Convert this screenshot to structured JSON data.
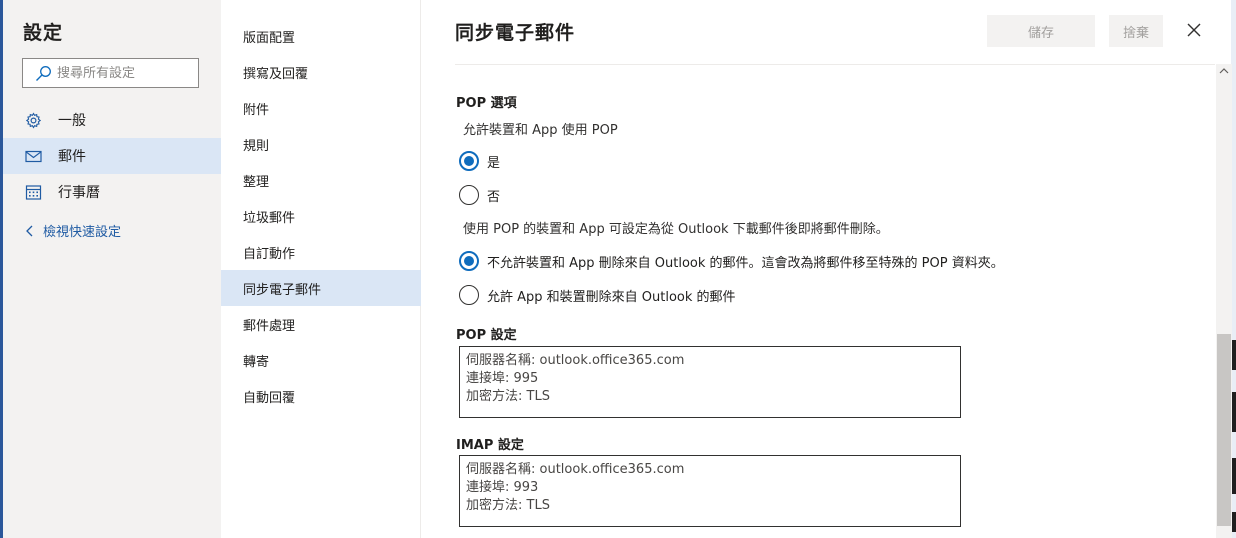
{
  "settings": {
    "title": "設定",
    "search_placeholder": "搜尋所有設定",
    "nav": [
      {
        "label": "一般",
        "icon": "gear-icon"
      },
      {
        "label": "郵件",
        "icon": "mail-icon"
      },
      {
        "label": "行事曆",
        "icon": "calendar-icon"
      }
    ],
    "selected_nav": "郵件",
    "back_link": "檢視快速設定"
  },
  "mail_categories": {
    "items": [
      "版面配置",
      "撰寫及回覆",
      "附件",
      "規則",
      "整理",
      "垃圾郵件",
      "自訂動作",
      "同步電子郵件",
      "郵件處理",
      "轉寄",
      "自動回覆"
    ],
    "selected": "同步電子郵件"
  },
  "panel": {
    "title": "同步電子郵件",
    "save_label": "儲存",
    "discard_label": "捨棄"
  },
  "pop_options": {
    "heading": "POP 選項",
    "question": "允許裝置和 App 使用 POP",
    "yes_label": "是",
    "no_label": "否",
    "enabled": true,
    "delete_note": "使用 POP 的裝置和 App 可設定為從 Outlook 下載郵件後即將郵件刪除。",
    "disallow_delete_label": "不允許裝置和 App 刪除來自 Outlook 的郵件。這會改為將郵件移至特殊的 POP 資料夾。",
    "allow_delete_label": "允許 App 和裝置刪除來自 Outlook 的郵件",
    "disallow_delete_selected": true
  },
  "pop_settings": {
    "heading": "POP 設定",
    "server": "伺服器名稱: outlook.office365.com",
    "port": "連接埠: 995",
    "encryption": "加密方法: TLS"
  },
  "imap_settings": {
    "heading": "IMAP 設定",
    "server": "伺服器名稱: outlook.office365.com",
    "port": "連接埠: 993",
    "encryption": "加密方法: TLS"
  },
  "colors": {
    "accent": "#0f6cbd",
    "selected_bg": "#dae6f5",
    "sidebar_bg": "#f3f2f1",
    "link": "#1f5ba3"
  }
}
